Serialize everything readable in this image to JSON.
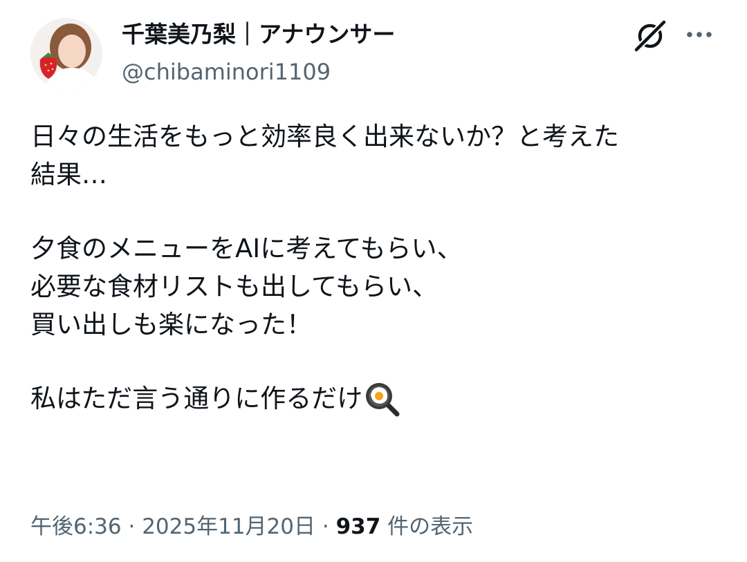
{
  "author": {
    "display_name": "千葉美乃梨｜アナウンサー",
    "handle": "@chibaminori1109"
  },
  "header_actions": {
    "grok_icon": "grok-slash-icon",
    "more_icon": "more-dots-icon"
  },
  "tweet": {
    "lines": [
      "日々の生活をもっと効率良く出来ないか？と考えた",
      "結果…",
      "",
      "夕食のメニューをAIに考えてもらい、",
      "必要な食材リストも出してもらい、",
      "買い出しも楽になった！",
      "",
      "私はただ言う通りに作るだけ"
    ],
    "trailing_emoji": "frying-pan-egg-icon"
  },
  "meta": {
    "time": "午後6:36",
    "separator": "·",
    "date": "2025年11月20日",
    "views_count": "937",
    "views_label": "件の表示"
  }
}
